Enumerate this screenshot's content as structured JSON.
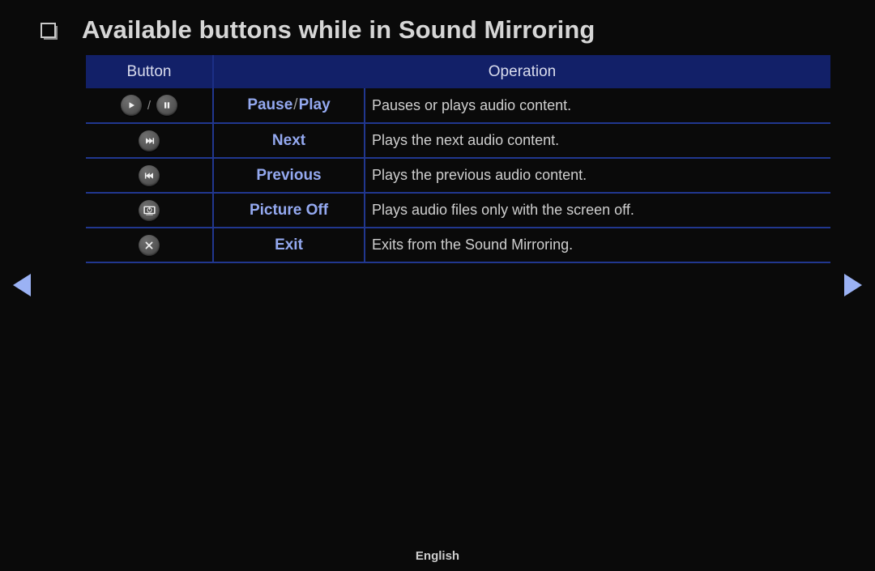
{
  "page": {
    "title": "Available buttons while in Sound Mirroring",
    "bullet_icon": "square-bullet-icon",
    "background_color": "#0a0a0a"
  },
  "colors": {
    "header_bg": "#122068",
    "grid_line": "#21378f",
    "label_text": "#94a9f0",
    "body_text": "#cfcfcf",
    "arrow": "#9bb2f4"
  },
  "table": {
    "headers": {
      "button": "Button",
      "operation": "Operation"
    },
    "rows": [
      {
        "icons": [
          "play-icon",
          "pause-icon"
        ],
        "icon_separator": "/",
        "label_prefix": "Pause",
        "label_separator": "/",
        "label_suffix": "Play",
        "operation": "Pauses or plays audio content."
      },
      {
        "icons": [
          "next-track-icon"
        ],
        "label": "Next",
        "operation": "Plays the next audio content."
      },
      {
        "icons": [
          "previous-track-icon"
        ],
        "label": "Previous",
        "operation": "Plays the previous audio content."
      },
      {
        "icons": [
          "picture-off-icon"
        ],
        "label": "Picture Off",
        "operation": "Plays audio files only with the screen off."
      },
      {
        "icons": [
          "exit-icon"
        ],
        "label": "Exit",
        "operation": "Exits from the Sound Mirroring."
      }
    ]
  },
  "navigation": {
    "previous_page_icon": "arrow-left-icon",
    "next_page_icon": "arrow-right-icon"
  },
  "footer": {
    "language": "English"
  }
}
